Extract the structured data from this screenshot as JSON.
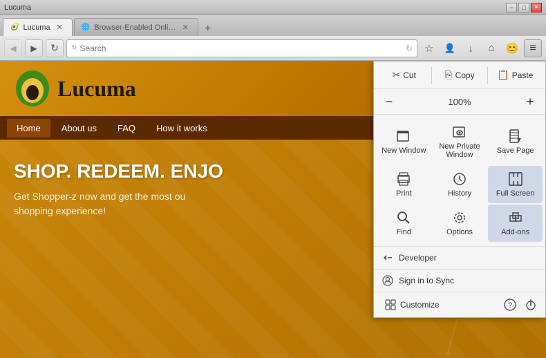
{
  "titleBar": {
    "title": "Lucuma",
    "minimize": "−",
    "maximize": "□",
    "close": "✕"
  },
  "tabs": [
    {
      "label": "Lucuma",
      "active": true
    },
    {
      "label": "Browser-Enabled Online Advert...",
      "active": false
    }
  ],
  "tabNew": "+",
  "navBar": {
    "back": "◀",
    "forward": "▶",
    "reload": "↻",
    "addressPlaceholder": "Search",
    "addressIcon": "🔒",
    "bookmarkIcon": "☆",
    "downloadsIcon": "↓",
    "homeIcon": "⌂",
    "syncIcon": "😊",
    "menuIcon": "≡"
  },
  "lucuma": {
    "heading": "SHOP. REDEEM. ENJO",
    "subtext": "Get Shopper-z now and get the most ou",
    "subtext2": "shopping experience!",
    "navItems": [
      "Home",
      "About us",
      "FAQ",
      "How it works"
    ]
  },
  "menu": {
    "cut": "Cut",
    "copy": "Copy",
    "paste": "Paste",
    "zoom": "100%",
    "zoomMinus": "−",
    "zoomPlus": "+",
    "gridItems": [
      {
        "label": "New Window",
        "icon": "window"
      },
      {
        "label": "New Private Window",
        "icon": "private"
      },
      {
        "label": "Save Page",
        "icon": "savepage"
      },
      {
        "label": "Print",
        "icon": "print"
      },
      {
        "label": "History",
        "icon": "history"
      },
      {
        "label": "Full Screen",
        "icon": "fullscreen"
      },
      {
        "label": "Find",
        "icon": "find"
      },
      {
        "label": "Options",
        "icon": "options"
      },
      {
        "label": "Add-ons",
        "icon": "addons"
      }
    ],
    "developer": "Developer",
    "signIn": "Sign in to Sync",
    "customize": "Customize",
    "helpIcon": "?",
    "powerIcon": "⏻"
  }
}
